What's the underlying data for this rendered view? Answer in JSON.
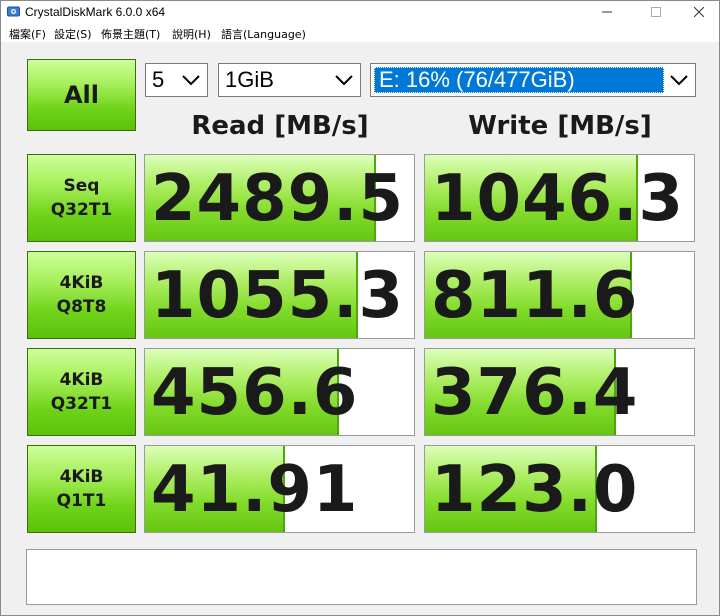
{
  "window": {
    "title": "CrystalDiskMark 6.0.0 x64"
  },
  "menu": [
    "檔案(F)",
    "設定(S)",
    "佈景主題(T)",
    "說明(H)",
    "語言(Language)"
  ],
  "controls": {
    "all_label": "All",
    "count": "5",
    "size": "1GiB",
    "drive": "E: 16% (76/477GiB)"
  },
  "columns": {
    "read": "Read [MB/s]",
    "write": "Write [MB/s]"
  },
  "rows": [
    {
      "label": "Seq\nQ32T1",
      "read": "2489.5",
      "write": "1046.3",
      "read_fraction": 0.86,
      "write_fraction": 0.79
    },
    {
      "label": "4KiB\nQ8T8",
      "read": "1055.3",
      "write": "811.6",
      "read_fraction": 0.79,
      "write_fraction": 0.77
    },
    {
      "label": "4KiB\nQ32T1",
      "read": "456.6",
      "write": "376.4",
      "read_fraction": 0.72,
      "write_fraction": 0.71
    },
    {
      "label": "4KiB\nQ1T1",
      "read": "41.91",
      "write": "123.0",
      "read_fraction": 0.52,
      "write_fraction": 0.64
    }
  ],
  "comment": ""
}
